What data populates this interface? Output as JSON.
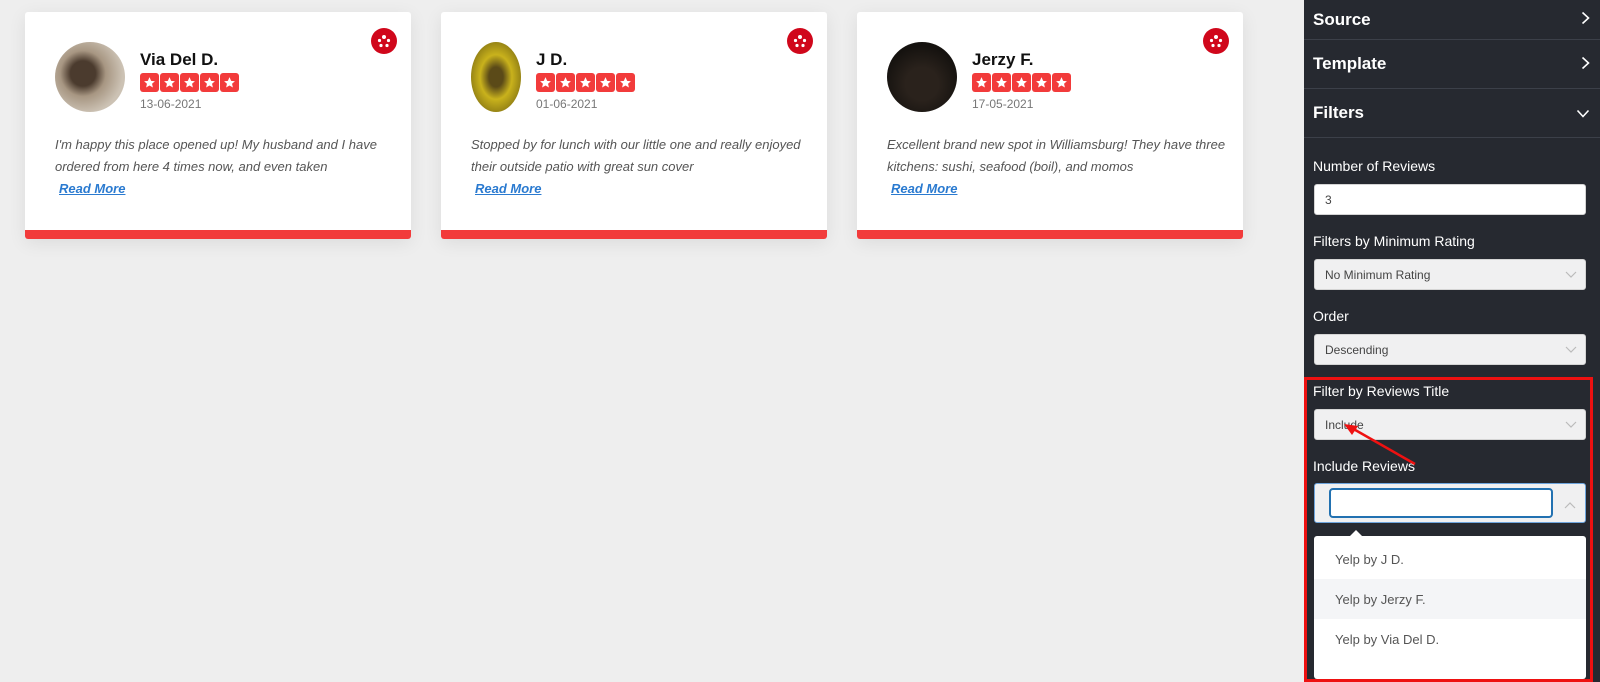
{
  "reviews": [
    {
      "name": "Via Del D.",
      "rating": 5,
      "date": "13-06-2021",
      "text": "I'm happy this place opened up! My husband and I have ordered from here 4 times now, and even taken",
      "read_more": "Read More",
      "source_icon": "yelp-icon",
      "avatar_color": "#8a7862"
    },
    {
      "name": "J D.",
      "rating": 5,
      "date": "01-06-2021",
      "text": "Stopped by for lunch with our little one and really enjoyed their outside patio with great sun cover",
      "read_more": "Read More",
      "source_icon": "yelp-icon",
      "avatar_color": "#b7a21c"
    },
    {
      "name": "Jerzy F.",
      "rating": 5,
      "date": "17-05-2021",
      "text": "Excellent brand new spot in Williamsburg! They have three kitchens: sushi, seafood (boil), and momos",
      "read_more": "Read More",
      "source_icon": "yelp-icon",
      "avatar_color": "#1c1a18"
    }
  ],
  "sidebar": {
    "sections": [
      {
        "label": "Source",
        "state": "collapsed"
      },
      {
        "label": "Template",
        "state": "collapsed"
      },
      {
        "label": "Filters",
        "state": "expanded"
      }
    ],
    "fields": {
      "number_of_reviews": {
        "label": "Number of Reviews",
        "value": "3"
      },
      "min_rating": {
        "label": "Filters by Minimum Rating",
        "value": "No Minimum Rating"
      },
      "order": {
        "label": "Order",
        "value": "Descending"
      },
      "filter_title": {
        "label": "Filter by Reviews Title",
        "value": "Include"
      },
      "include_reviews": {
        "label": "Include Reviews",
        "search_value": "",
        "options": [
          "Yelp by J D.",
          "Yelp by Jerzy F.",
          "Yelp by Via Del D."
        ]
      }
    }
  },
  "colors": {
    "accent_red": "#f23b3b",
    "yelp_red": "#d0071b",
    "sidebar_bg": "#262930",
    "link_blue": "#2a7ad0",
    "annotation_red": "#ee1111"
  }
}
